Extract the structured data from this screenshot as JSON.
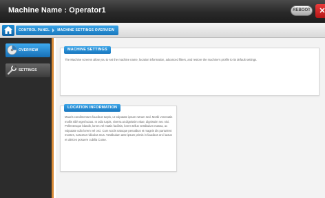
{
  "window": {
    "title": "Machine Name : Operator1",
    "reboot_label": "REBOOT",
    "close_label": "✕"
  },
  "breadcrumb": {
    "items": [
      "CONTROL PANEL",
      "MACHINE SETTINGS OVERVIEW"
    ]
  },
  "sidebar": {
    "items": [
      {
        "label": "OVERVIEW",
        "icon": "disc-icon",
        "active": true
      },
      {
        "label": "SETTINGS",
        "icon": "wrench-icon",
        "active": false
      }
    ]
  },
  "panels": {
    "machine_settings": {
      "title": "MACHINE SETTINGS",
      "body": "The Machine screens allow you to set the machine name, location information, advanced filters, and restore the machine's profile to its default settings."
    },
    "location_information": {
      "title": "LOCATION INFORMATION",
      "body": "Mauris condimentum faucibus turpis, ut vulputate ipsum rutrum sed. Morbi venenatis mollis nibh eget luctus. In odio turpis, viverra at dignissim vitae, dignissim nec nisi. Pellentesque blandit, lorem vel mattis facilisis, lorem tellus vestibulum massa, ac vulputate odio lorem vel orci. Cum sociis natoque penatibus et magnis dis parturient montes, nascetur ridiculus mus. Vestibulum ante ipsum primis in faucibus orci luctus et ultrices posuere cubilia Curae."
    }
  },
  "colors": {
    "accent_blue": "#1f8fd6",
    "sidebar_border": "#d98b37",
    "close_red": "#d62a2a"
  }
}
